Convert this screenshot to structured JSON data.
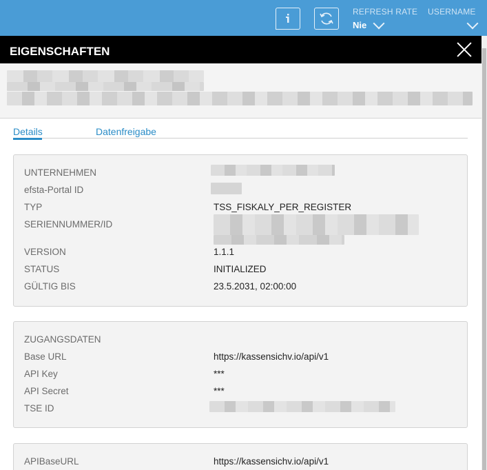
{
  "topbar": {
    "info_icon": "info-speech-bubble-icon",
    "refresh_icon": "refresh-icon",
    "refresh_rate_label": "REFRESH RATE",
    "refresh_rate_value": "Nie",
    "username_label": "USERNAME",
    "accent_color": "#4a9cd6"
  },
  "dialog": {
    "title": "EIGENSCHAFTEN",
    "close_icon": "close-icon"
  },
  "tabs": [
    {
      "label": "Details",
      "active": true
    },
    {
      "label": "Datenfreigabe",
      "active": false
    }
  ],
  "details": {
    "company_label": "UNTERNEHMEN",
    "portal_id_label": "efsta-Portal ID",
    "type_label": "TYP",
    "type_value": "TSS_FISKALY_PER_REGISTER",
    "serial_label": "SERIENNUMMER/ID",
    "version_label": "VERSION",
    "version_value": "1.1.1",
    "status_label": "STATUS",
    "status_value": "INITIALIZED",
    "valid_until_label": "GÜLTIG BIS",
    "valid_until_value": "23.5.2031, 02:00:00"
  },
  "access": {
    "heading": "ZUGANGSDATEN",
    "base_url_label": "Base URL",
    "base_url_value": "https://kassensichv.io/api/v1",
    "api_key_label": "API Key",
    "api_key_value": "***",
    "api_secret_label": "API Secret",
    "api_secret_value": "***",
    "tse_id_label": "TSE ID"
  },
  "extra": {
    "api_base_url_label": "APIBaseURL",
    "api_base_url_value": "https://kassensichv.io/api/v1"
  }
}
